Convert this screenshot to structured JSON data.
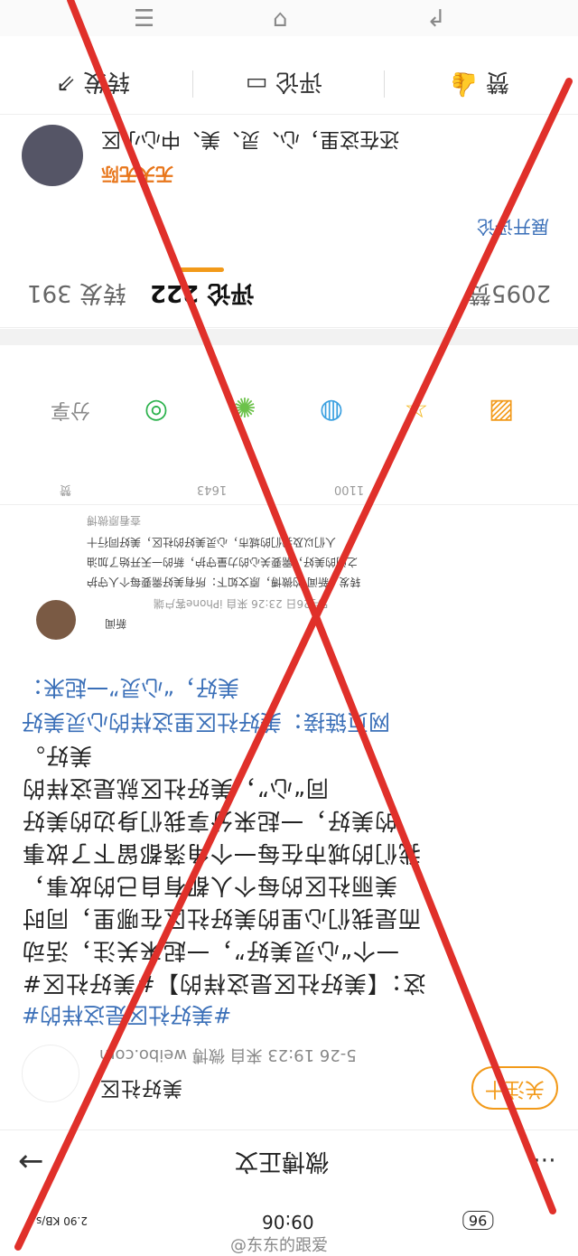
{
  "nav": {
    "menu_icon": "menu-icon",
    "home_icon": "home-icon",
    "back_icon": "back-icon"
  },
  "actions": {
    "repost": "转发",
    "comment": "评论",
    "like": "赞"
  },
  "top_comment": {
    "username": "无天无际",
    "text": "还在这里，心、灵、美、中心小区",
    "link": "展开评论"
  },
  "tabs": {
    "reposts": "转发 391",
    "comments": "评论 222",
    "likes": "2095赞"
  },
  "share": {
    "label": "分享",
    "icons": [
      "wechat-icon",
      "moments-icon",
      "qq-icon",
      "favorite-icon",
      "chart-icon"
    ]
  },
  "mini_actions": {
    "like": "赞",
    "repost": "1643",
    "comment": "1100"
  },
  "embedded": {
    "author": "新闻",
    "meta": "5月26日 23:26 来自 iPhone客户端",
    "lines": [
      "转发 · 新闻 的微博，原文如下：所有美好需要每个人守护",
      "之间的美好，需要关心的力量守护，新的一天开始了加油",
      "人们以及我们的城市，心灵美好的社区，美好同行十"
    ],
    "footer": "查看原微博"
  },
  "post": {
    "tag_line": "#美好社区是这样的#",
    "link_line": "网页链接：美好社区里这样的心灵美好",
    "hashtag_line": "美好，“心灵”一起来：",
    "body_lines": [
      "这：【美好社区是这样的】#美好社区#",
      "一个“心灵美好”，一起来关注，活动",
      "而是我们心里的美好社区在哪里，同时",
      "美丽社区的每个人都有自己的故事，",
      "我们的城市在每一个角落都留下了故事",
      "的美好，一起来分享我们身边的美好",
      "同“心”，美好社区就是这样的",
      "美好。"
    ],
    "source": "5-26 19:23 来自 微博 weibo.com",
    "author": "美好社区",
    "follow": "关注十"
  },
  "bottom": {
    "title": "微博正文",
    "back_icon": "arrow-left-icon",
    "more_icon": "more-icon"
  },
  "status": {
    "time": "09:06",
    "battery": "96",
    "net": "2.90 KB/s",
    "watermark": "@东东的跟爱"
  },
  "colors": {
    "accent": "#f29a1a",
    "link": "#3a6fb8",
    "cross": "#e0302a"
  }
}
